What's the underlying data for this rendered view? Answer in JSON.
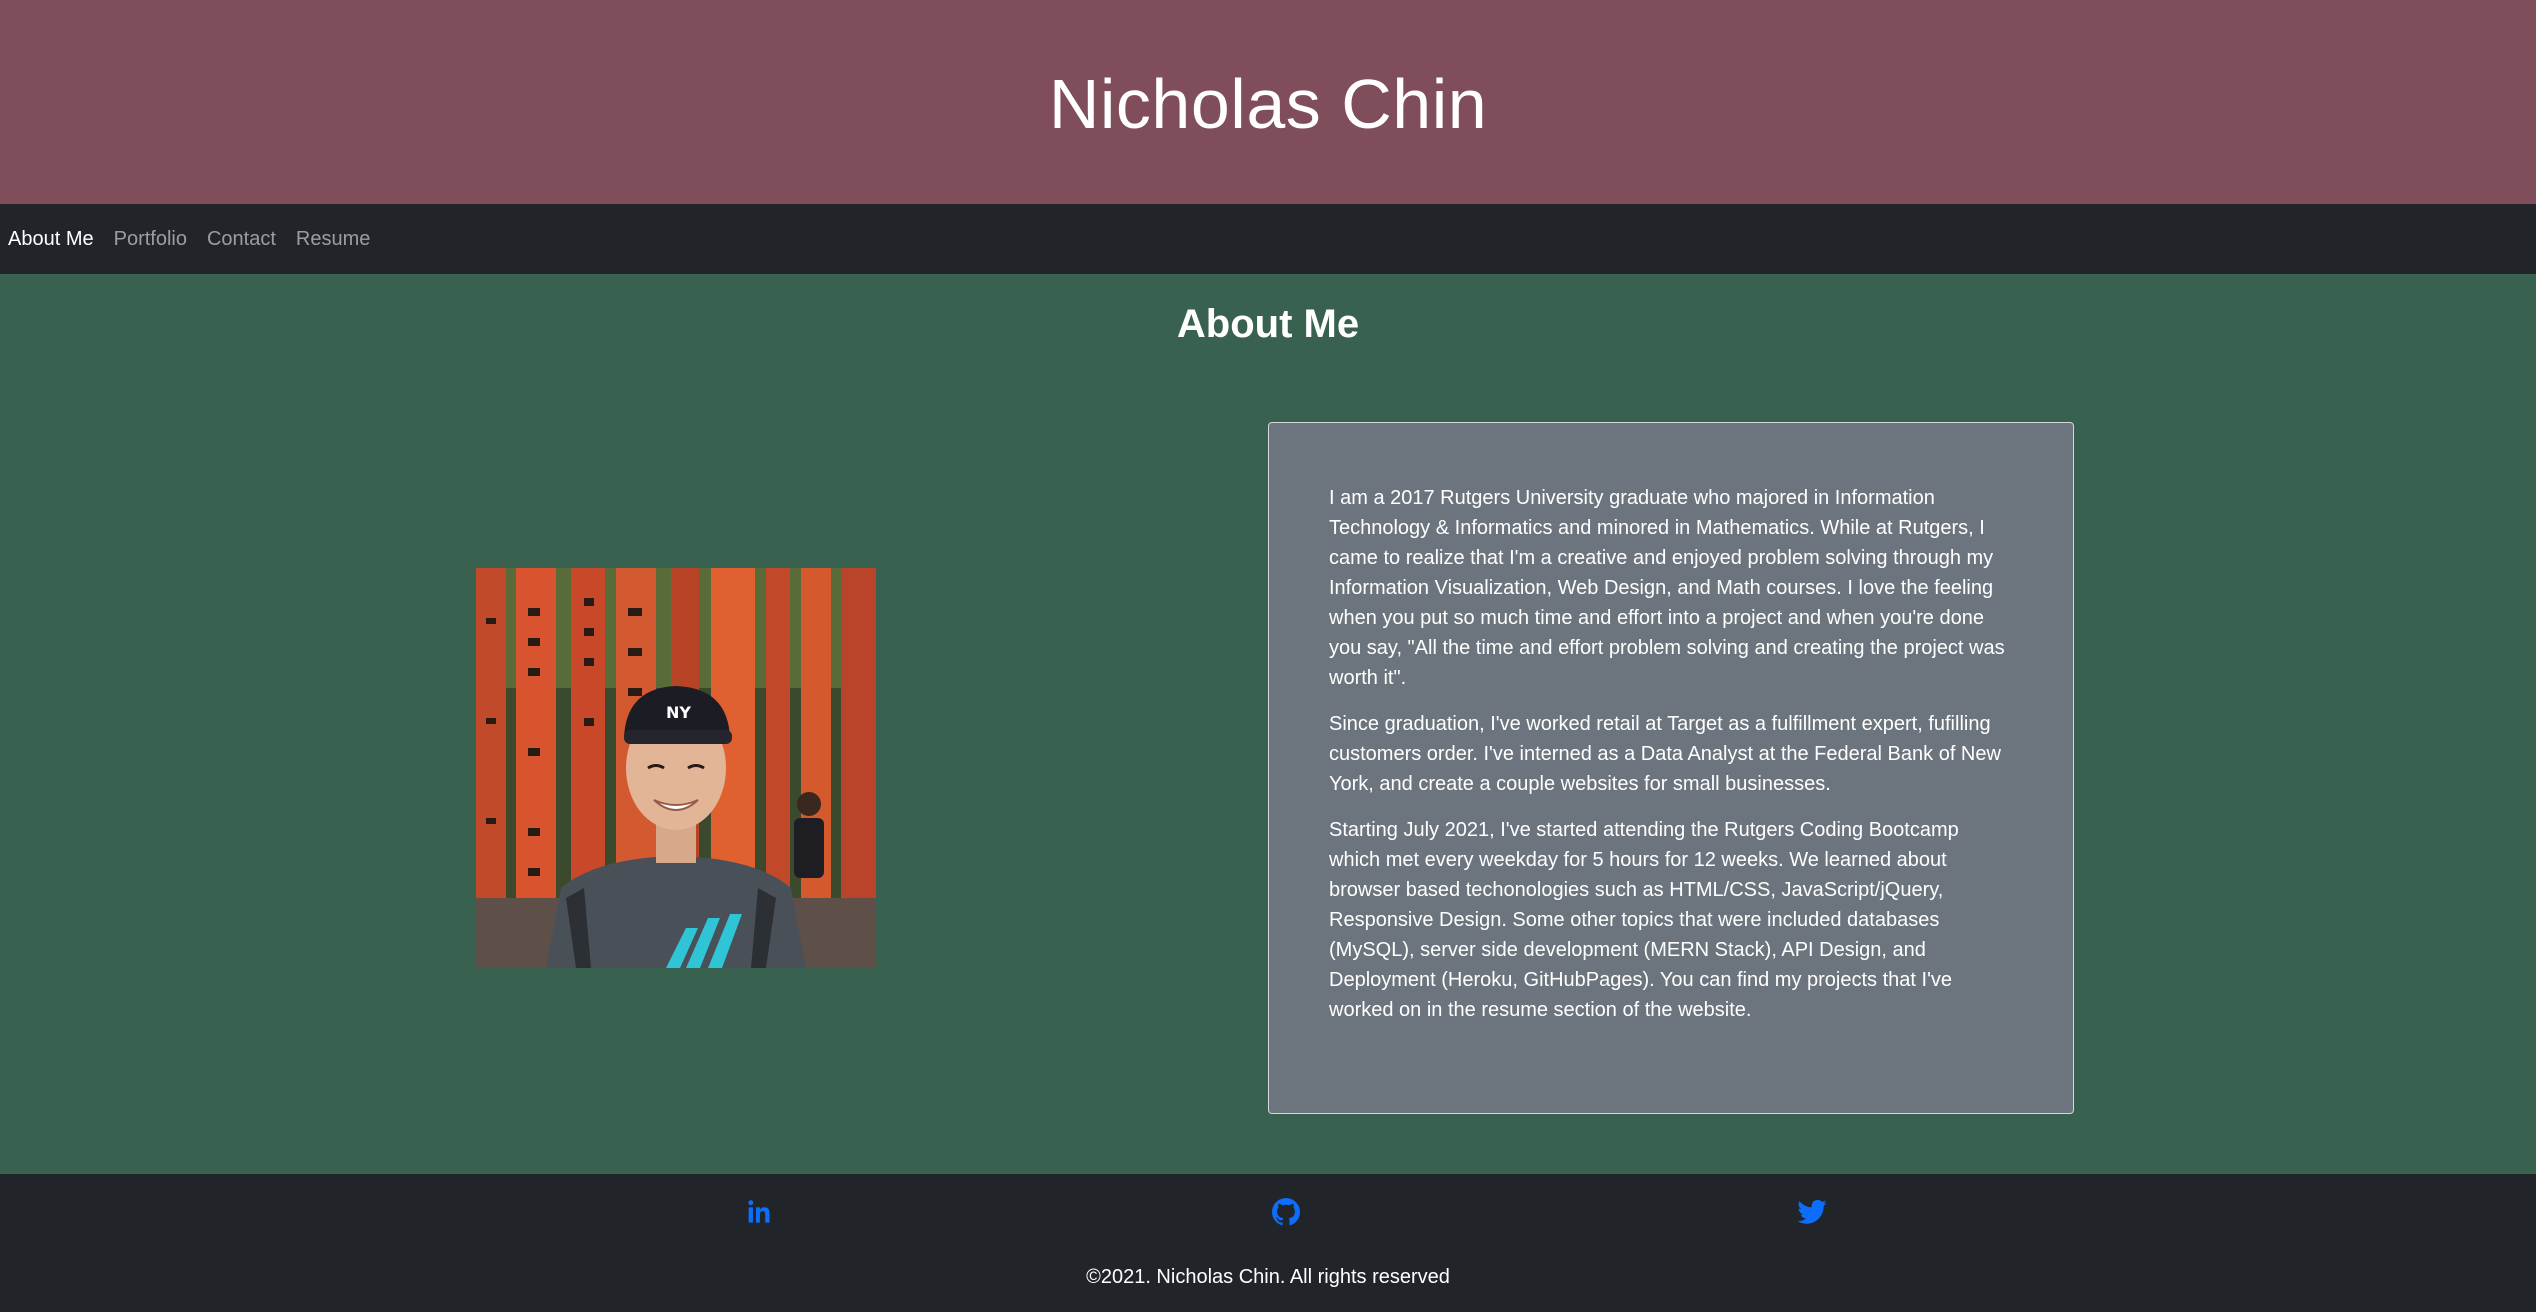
{
  "header": {
    "site_title": "Nicholas Chin"
  },
  "nav": {
    "items": [
      {
        "label": "About Me",
        "active": true
      },
      {
        "label": "Portfolio",
        "active": false
      },
      {
        "label": "Contact",
        "active": false
      },
      {
        "label": "Resume",
        "active": false
      }
    ]
  },
  "about": {
    "heading": "About Me",
    "photo_icon": "profile-photo",
    "paragraphs": [
      "I am a 2017 Rutgers University graduate who majored in Information Technology & Informatics and minored in Mathematics. While at Rutgers, I came to realize that I'm a creative and enjoyed problem solving through my Information Visualization, Web Design, and Math courses. I love the feeling when you put so much time and effort into a project and when you're done you say, \"All the time and effort problem solving and creating the project was worth it\".",
      "Since graduation, I've worked retail at Target as a fulfillment expert, fufilling customers order. I've interned as a Data Analyst at the Federal Bank of New York, and create a couple websites for small businesses.",
      "Starting July 2021, I've started attending the Rutgers Coding Bootcamp which met every weekday for 5 hours for 12 weeks. We learned about browser based techonologies such as HTML/CSS, JavaScript/jQuery, Responsive Design. Some other topics that were included databases (MySQL), server side development (MERN Stack), API Design, and Deployment (Heroku, GitHubPages). You can find my projects that I've worked on in the resume section of the website."
    ]
  },
  "footer": {
    "social": [
      {
        "icon": "linkedin-icon"
      },
      {
        "icon": "github-icon"
      },
      {
        "icon": "twitter-icon"
      }
    ],
    "copyright": "©2021. Nicholas Chin. All rights reserved"
  },
  "colors": {
    "header_bg": "#804e5a",
    "nav_bg": "#212529",
    "main_bg": "#396150",
    "card_bg": "#6c757d",
    "footer_bg": "#212529",
    "social_icon": "#0d6efd"
  }
}
